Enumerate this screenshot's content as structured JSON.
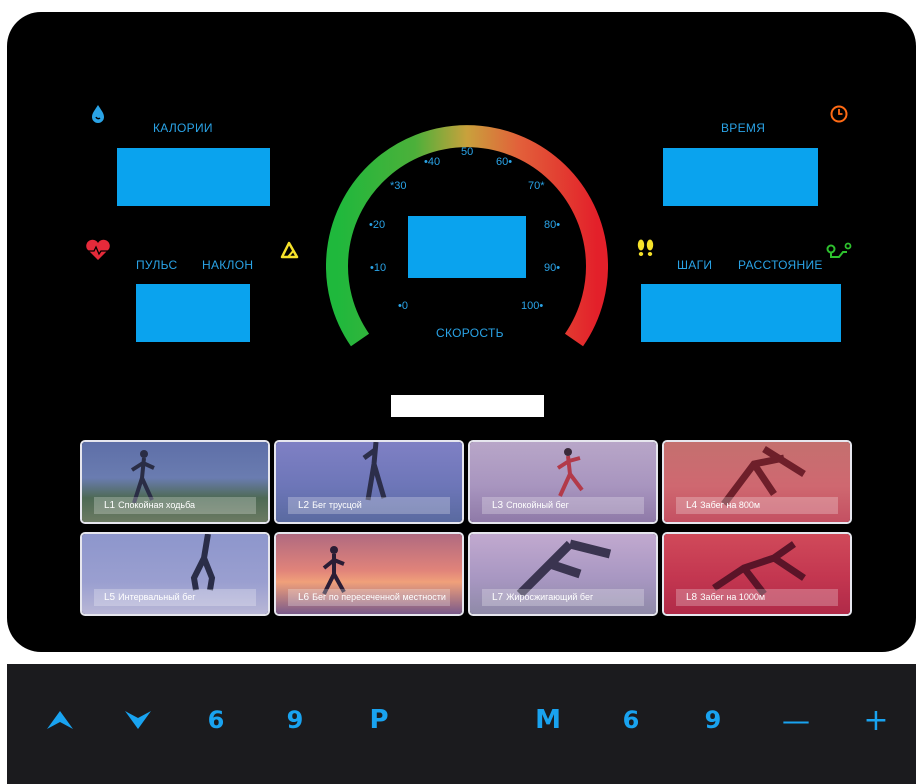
{
  "colors": {
    "accent": "#19a3f0",
    "screen": "#0aa3ee",
    "console": "#000000",
    "heart": "#e52a3a",
    "incline": "#f5e12a",
    "steps": "#f5e12a",
    "time": "#ff6a14",
    "distance": "#2ec12e"
  },
  "left": {
    "calories_label": "КАЛОРИИ",
    "pulse_label": "ПУЛЬС",
    "incline_label": "НАКЛОН",
    "icons": [
      "drop-icon",
      "heart-icon",
      "incline-icon"
    ]
  },
  "right": {
    "time_label": "ВРЕМЯ",
    "steps_label": "ШАГИ",
    "distance_label": "РАССТОЯНИЕ",
    "icons": [
      "clock-icon",
      "footprints-icon",
      "route-icon"
    ]
  },
  "speedometer": {
    "label": "СКОРОСТЬ",
    "ticks": [
      "•0",
      "•10",
      "•20",
      "*30",
      "•40",
      "50",
      "60•",
      "70*",
      "80•",
      "90•",
      "100•"
    ]
  },
  "programs": [
    {
      "code": "L1",
      "name": "Спокойная ходьба"
    },
    {
      "code": "L2",
      "name": "Бег трусцой"
    },
    {
      "code": "L3",
      "name": "Спокойный бег"
    },
    {
      "code": "L4",
      "name": "Забег на 800м"
    },
    {
      "code": "L5",
      "name": "Интервальный бег"
    },
    {
      "code": "L6",
      "name": "Бег по пересеченной местности"
    },
    {
      "code": "L7",
      "name": "Жиросжигающий бег"
    },
    {
      "code": "L8",
      "name": "Забег на 1000м"
    }
  ],
  "buttons": {
    "up": "up-arrow-icon",
    "down": "down-arrow-icon",
    "left_six": "6",
    "left_nine": "9",
    "p": "P",
    "m": "M",
    "right_six": "6",
    "right_nine": "9",
    "minus": "—",
    "plus": "+"
  }
}
